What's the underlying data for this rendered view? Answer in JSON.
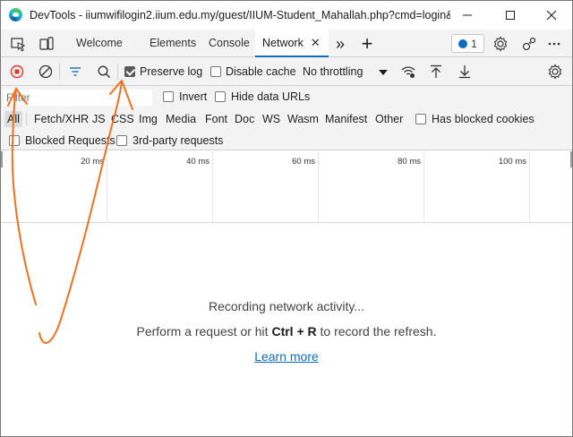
{
  "window": {
    "title": "DevTools - iiumwifilogin2.iium.edu.my/guest/IIUM-Student_Mahallah.php?cmd=login&...",
    "app_icon": "edge-icon"
  },
  "tabs": {
    "items": [
      {
        "label": "Welcome"
      },
      {
        "label": "Elements"
      },
      {
        "label": "Console"
      },
      {
        "label": "Network",
        "active": true
      }
    ],
    "close_glyph": "✕",
    "more_glyph": "»",
    "add_glyph": "+",
    "issues_count": "1"
  },
  "toolbar": {
    "preserve_log_label": "Preserve log",
    "preserve_log_checked": true,
    "disable_cache_label": "Disable cache",
    "disable_cache_checked": false,
    "throttling_value": "No throttling"
  },
  "filters": {
    "filter_placeholder": "Filter",
    "invert_label": "Invert",
    "hide_data_urls_label": "Hide data URLs",
    "types": [
      "All",
      "Fetch/XHR",
      "JS",
      "CSS",
      "Img",
      "Media",
      "Font",
      "Doc",
      "WS",
      "Wasm",
      "Manifest",
      "Other"
    ],
    "active_type": "All",
    "has_blocked_cookies_label": "Has blocked cookies",
    "blocked_requests_label": "Blocked Requests",
    "third_party_label": "3rd-party requests"
  },
  "timeline": {
    "ticks": [
      "20 ms",
      "40 ms",
      "60 ms",
      "80 ms",
      "100 ms"
    ]
  },
  "empty_state": {
    "title": "Recording network activity...",
    "hint_prefix": "Perform a request or hit ",
    "hint_shortcut": "Ctrl + R",
    "hint_suffix": " to record the refresh.",
    "learn_more": "Learn more"
  },
  "colors": {
    "accent": "#0f6cbd",
    "record_red": "#d83b2b",
    "annotation_orange": "#f07020"
  }
}
